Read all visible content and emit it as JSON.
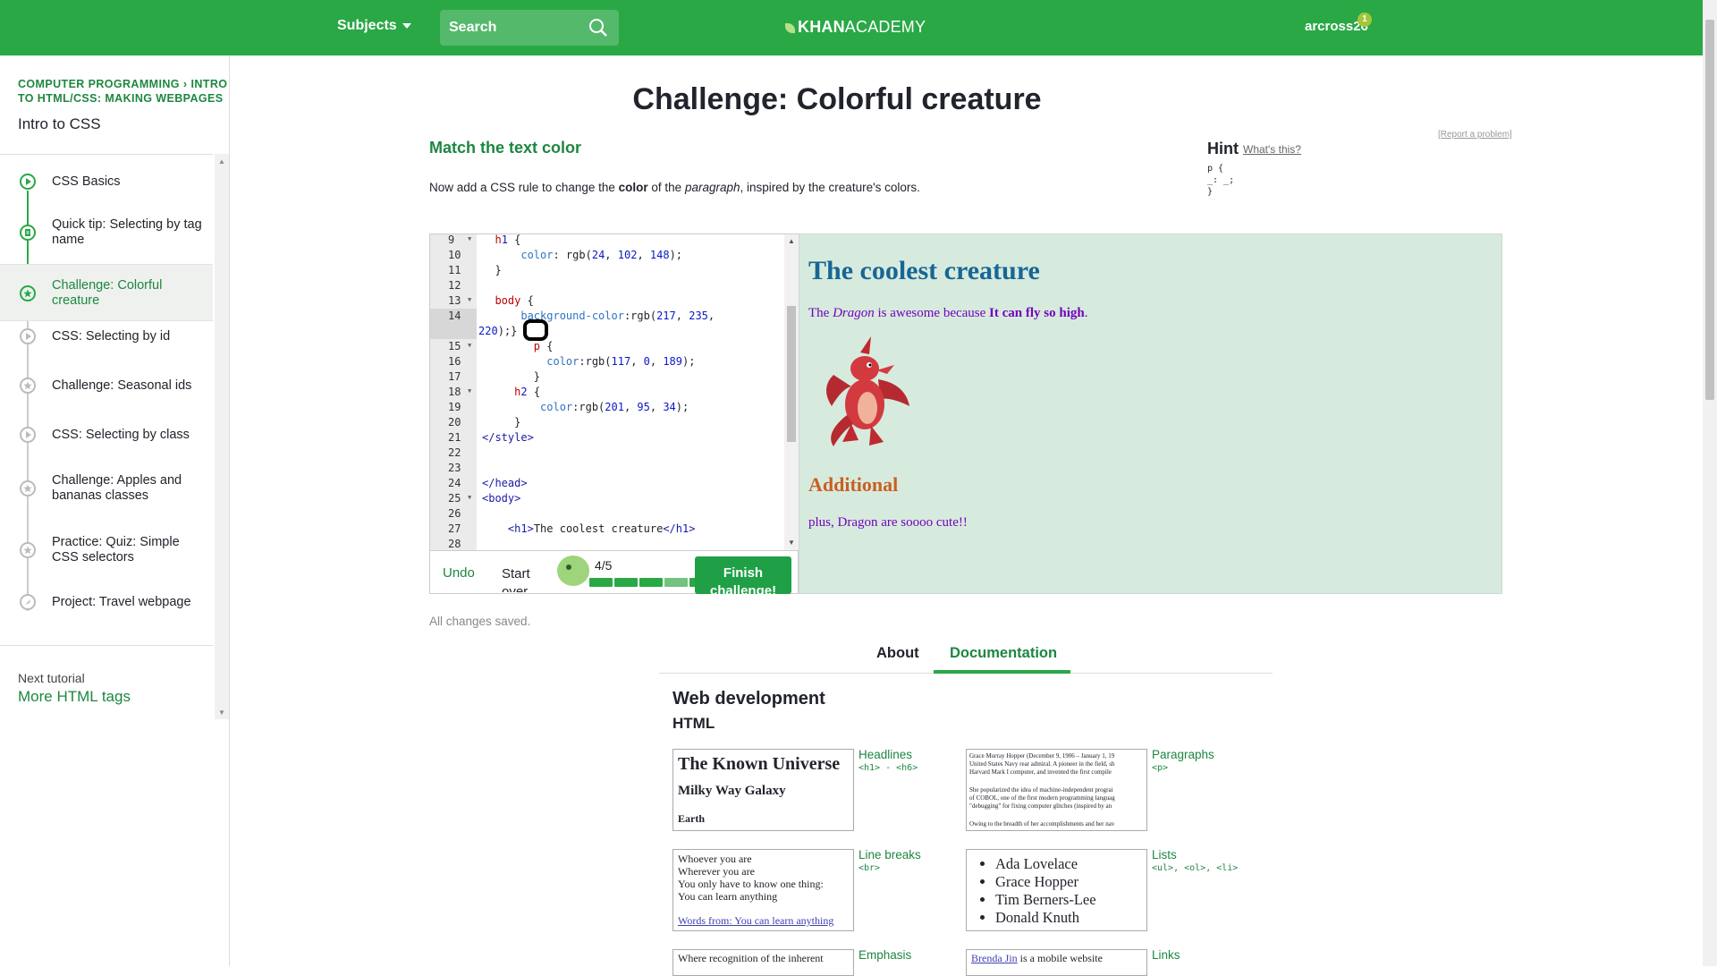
{
  "header": {
    "subjects_label": "Subjects",
    "search_placeholder": "Search",
    "logo_bold": "KHAN",
    "logo_thin": "ACADEMY",
    "username": "arcross26",
    "notification_count": "1",
    "brand_color": "#2aa846"
  },
  "sidebar": {
    "breadcrumb_1": "COMPUTER PROGRAMMING",
    "breadcrumb_2": "INTRO TO HTML/CSS: MAKING WEBPAGES",
    "title": "Intro to CSS",
    "items": [
      {
        "label": "CSS Basics",
        "icon": "play-icon",
        "state": "done"
      },
      {
        "label": "Quick tip: Selecting by tag name",
        "icon": "document-icon",
        "state": "done"
      },
      {
        "label": "Challenge: Colorful creature",
        "icon": "star-icon",
        "state": "active"
      },
      {
        "label": "CSS: Selecting by id",
        "icon": "play-icon",
        "state": "todo"
      },
      {
        "label": "Challenge: Seasonal ids",
        "icon": "star-icon",
        "state": "todo"
      },
      {
        "label": "CSS: Selecting by class",
        "icon": "play-icon",
        "state": "todo"
      },
      {
        "label": "Challenge: Apples and bananas classes",
        "icon": "star-icon",
        "state": "todo"
      },
      {
        "label": "Practice: Quiz: Simple CSS selectors",
        "icon": "star-icon",
        "state": "todo"
      },
      {
        "label": "Project: Travel webpage",
        "icon": "rocket-icon",
        "state": "todo"
      }
    ],
    "next_label": "Next tutorial",
    "next_link": "More HTML tags"
  },
  "challenge": {
    "title": "Challenge: Colorful creature",
    "step_title": "Match the text color",
    "desc_1": "Now add a CSS rule to change the ",
    "desc_bold": "color",
    "desc_2": " of the ",
    "desc_italic": "paragraph",
    "desc_3": ", inspired by the creature's colors.",
    "hint_label": "Hint",
    "hint_what": "What's this?",
    "hint_code": "p {\n_: _;\n}",
    "report": "[Report a problem]"
  },
  "editor": {
    "lines": [
      {
        "n": "9",
        "fold": true,
        "text": "  h1 {"
      },
      {
        "n": "10",
        "fold": false,
        "text": "      color: rgb(24, 102, 148);"
      },
      {
        "n": "11",
        "fold": false,
        "text": "  }"
      },
      {
        "n": "12",
        "fold": false,
        "text": ""
      },
      {
        "n": "13",
        "fold": true,
        "text": "  body {"
      },
      {
        "n": "14",
        "fold": false,
        "text": "      background-color:rgb(217, 235,"
      },
      {
        "n": "",
        "fold": false,
        "text": "220);}"
      },
      {
        "n": "15",
        "fold": true,
        "text": "        p {"
      },
      {
        "n": "16",
        "fold": false,
        "text": "          color:rgb(117, 0, 189);"
      },
      {
        "n": "17",
        "fold": false,
        "text": "        }"
      },
      {
        "n": "18",
        "fold": true,
        "text": "     h2 {"
      },
      {
        "n": "19",
        "fold": false,
        "text": "         color:rgb(201, 95, 34);"
      },
      {
        "n": "20",
        "fold": false,
        "text": "     }"
      },
      {
        "n": "21",
        "fold": false,
        "text": "</style>"
      },
      {
        "n": "22",
        "fold": false,
        "text": ""
      },
      {
        "n": "23",
        "fold": false,
        "text": ""
      },
      {
        "n": "24",
        "fold": false,
        "text": "</head>"
      },
      {
        "n": "25",
        "fold": true,
        "text": "<body>"
      },
      {
        "n": "26",
        "fold": false,
        "text": ""
      },
      {
        "n": "27",
        "fold": false,
        "text": "    <h1>The coolest creature</h1>"
      },
      {
        "n": "28",
        "fold": false,
        "text": ""
      }
    ],
    "undo_label": "Undo",
    "start_over_label": "Start over",
    "progress_text": "4/5",
    "progress_value": 0.8,
    "finish_label": "Finish challenge!",
    "saved_text": "All changes saved."
  },
  "output": {
    "h1": "The coolest creature",
    "p_the": "The ",
    "p_creature": "Dragon",
    "p_mid": " is awesome because ",
    "p_bold": "It can fly so high",
    "p_end": ".",
    "h2": "Additional",
    "p2": "plus, Dragon are soooo cute!!",
    "bg_color": "#d9ebdc",
    "h1_color": "#186694",
    "p_color": "#7500bd",
    "h2_color": "#c95f22"
  },
  "tabs": {
    "about": "About",
    "documentation": "Documentation"
  },
  "docs": {
    "heading": "Web development",
    "subheading": "HTML",
    "headlines": {
      "label": "Headlines",
      "code": "<h1> - <h6>",
      "h1": "The Known Universe",
      "h2": "Milky Way Galaxy",
      "h3": "Earth"
    },
    "paragraphs": {
      "label": "Paragraphs",
      "code": "<p>",
      "line1": "Grace Murray Hopper (December 9, 1906 – January 1, 19",
      "line2": "United States Navy rear admiral. A pioneer in the field, sh",
      "line3": "Harvard Mark I computer, and invented the first compile",
      "line4": "She popularized the idea of machine-independent prograi",
      "line5": "of COBOL, one of the first modern programming languag",
      "line6": "\"debugging\" for fixing computer glitches (inspired by an",
      "line7": "Owing to the breadth of her accomplishments and her nav"
    },
    "linebreaks": {
      "label": "Line breaks",
      "code": "<br>",
      "l1": "Whoever you are",
      "l2": "Wherever you are",
      "l3": "You only have to know one thing:",
      "l4": "You can learn anything",
      "link": "Words from: You can learn anything"
    },
    "lists": {
      "label": "Lists",
      "code": "<ul>, <ol>, <li>",
      "items": [
        "Ada Lovelace",
        "Grace Hopper",
        "Tim Berners-Lee",
        "Donald Knuth"
      ]
    },
    "emphasis": {
      "label": "Emphasis",
      "text": "Where recognition of the inherent"
    },
    "links": {
      "label": "Links",
      "link": "Brenda Jin",
      "text": " is a mobile website"
    }
  }
}
